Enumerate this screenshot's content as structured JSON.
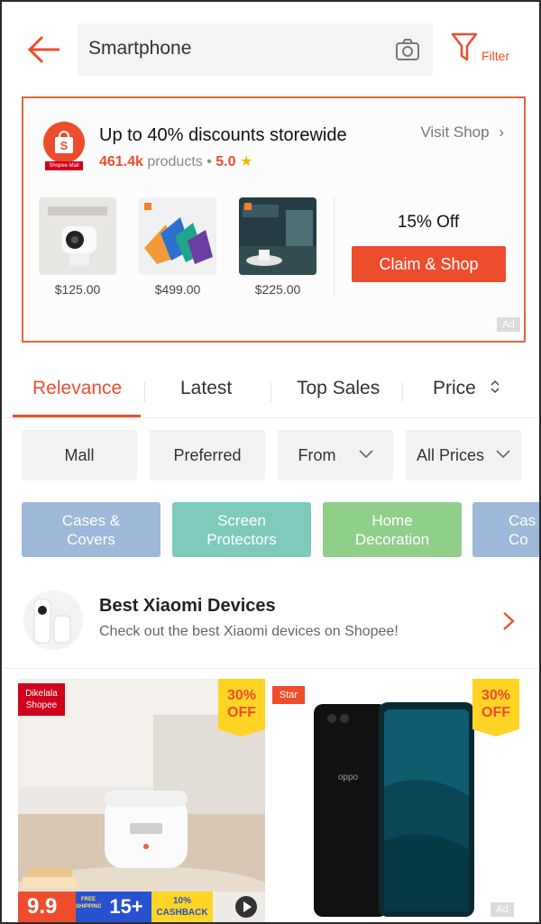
{
  "header": {
    "search_value": "Smartphone",
    "filter_label": "Filter",
    "icons": [
      "back-arrow-icon",
      "camera-icon",
      "filter-funnel-icon"
    ]
  },
  "ad": {
    "title": "Up to 40% discounts storewide",
    "products_count": "461.4k",
    "products_label": "products",
    "rating": "5.0",
    "visit_shop": "Visit Shop",
    "logo_tag": "Shopee Mall",
    "items": [
      {
        "price": "$125.00"
      },
      {
        "price": "$499.00"
      },
      {
        "price": "$225.00"
      }
    ],
    "discount": "15% Off",
    "claim_label": "Claim & Shop",
    "ad_label": "Ad"
  },
  "sort_tabs": [
    {
      "label": "Relevance",
      "active": true
    },
    {
      "label": "Latest",
      "active": false
    },
    {
      "label": "Top Sales",
      "active": false
    },
    {
      "label": "Price",
      "active": false
    }
  ],
  "filters": [
    {
      "label": "Mall"
    },
    {
      "label": "Preferred"
    },
    {
      "label": "From"
    },
    {
      "label": "All Prices"
    }
  ],
  "categories": [
    {
      "line1": "Cases &",
      "line2": "Covers",
      "color": "#9db8d8"
    },
    {
      "line1": "Screen",
      "line2": "Protectors",
      "color": "#7fc9bd"
    },
    {
      "line1": "Home",
      "line2": "Decoration",
      "color": "#8fcf8a"
    },
    {
      "line1": "Cas",
      "line2": "Co",
      "color": "#9db8d8"
    }
  ],
  "promo": {
    "title": "Best Xiaomi Devices",
    "subtitle": "Check out the best Xiaomi devices on Shopee!"
  },
  "products": [
    {
      "tag_line1": "Dikelala",
      "tag_line2": "Shopee",
      "off_pct": "30%",
      "off_word": "OFF",
      "promo_big": "9.9",
      "promo_ship": "FREE SHIPPING",
      "promo_15": "15+",
      "promo_cash": "10% CASHBACK"
    },
    {
      "tag_line1": "Star",
      "off_pct": "30%",
      "off_word": "OFF",
      "ad_label": "Ad"
    }
  ],
  "colors": {
    "accent": "#ee4d2d",
    "badge_yellow": "#ffd424"
  }
}
